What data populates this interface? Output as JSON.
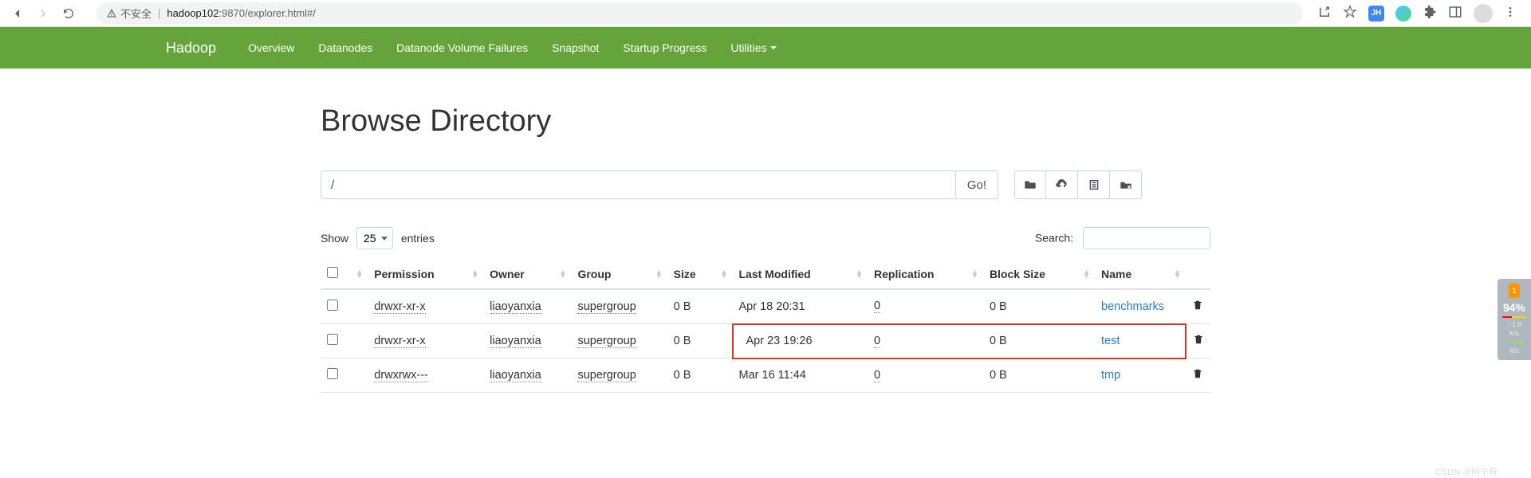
{
  "browser": {
    "security_label": "不安全",
    "url_host": "hadoop102",
    "url_port_path": ":9870/explorer.html#/",
    "ext_jh": "JH"
  },
  "nav": {
    "brand": "Hadoop",
    "links": [
      "Overview",
      "Datanodes",
      "Datanode Volume Failures",
      "Snapshot",
      "Startup Progress",
      "Utilities"
    ]
  },
  "page": {
    "title": "Browse Directory",
    "path_value": "/",
    "go_label": "Go!"
  },
  "table_ctrl": {
    "show_label": "Show",
    "entries_label": "entries",
    "entries_value": "25",
    "search_label": "Search:"
  },
  "columns": [
    "Permission",
    "Owner",
    "Group",
    "Size",
    "Last Modified",
    "Replication",
    "Block Size",
    "Name"
  ],
  "rows": [
    {
      "perm": "drwxr-xr-x",
      "owner": "liaoyanxia",
      "group": "supergroup",
      "size": "0 B",
      "mod": "Apr 18 20:31",
      "rep": "0",
      "block": "0 B",
      "name": "benchmarks",
      "hl": false
    },
    {
      "perm": "drwxr-xr-x",
      "owner": "liaoyanxia",
      "group": "supergroup",
      "size": "0 B",
      "mod": "Apr 23 19:26",
      "rep": "0",
      "block": "0 B",
      "name": "test",
      "hl": true
    },
    {
      "perm": "drwxrwx---",
      "owner": "liaoyanxia",
      "group": "supergroup",
      "size": "0 B",
      "mod": "Mar 16 11:44",
      "rep": "0",
      "block": "0 B",
      "name": "tmp",
      "hl": false
    }
  ],
  "widget": {
    "badge": "1",
    "pct": "94%",
    "l1": "1.9",
    "l2": "K/s",
    "l3": "6.4",
    "l4": "K/s"
  },
  "watermark": "CSDN @阿宁呀"
}
